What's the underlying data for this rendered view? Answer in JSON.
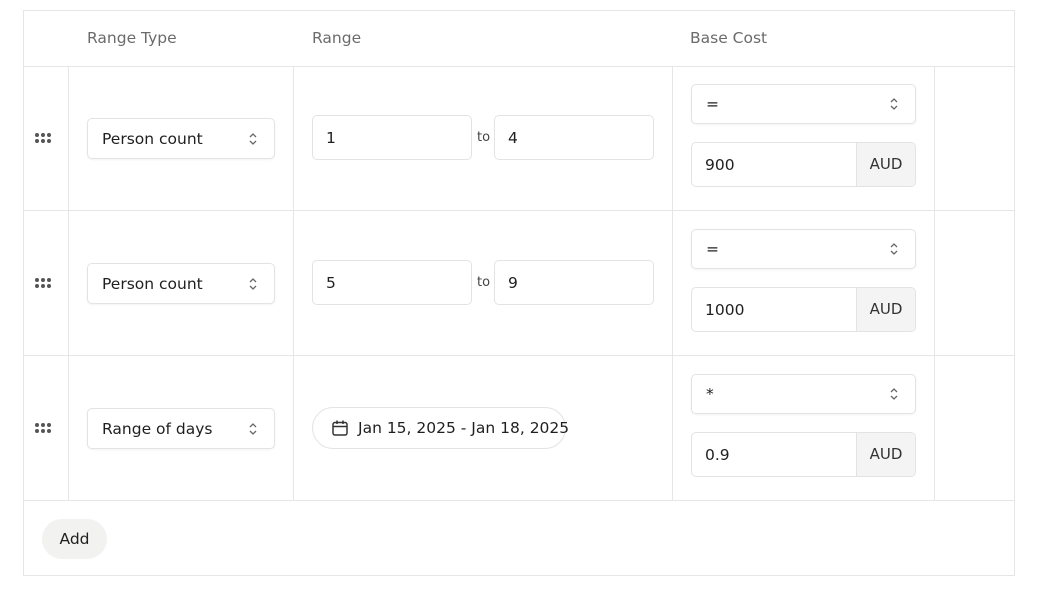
{
  "header": {
    "range_type": "Range Type",
    "range": "Range",
    "base_cost": "Base Cost"
  },
  "rows": [
    {
      "range_type": "Person count",
      "range_from": "1",
      "to_label": "to",
      "range_to": "4",
      "operator": "=",
      "cost_value": "900",
      "currency": "AUD"
    },
    {
      "range_type": "Person count",
      "range_from": "5",
      "to_label": "to",
      "range_to": "9",
      "operator": "=",
      "cost_value": "1000",
      "currency": "AUD"
    },
    {
      "range_type": "Range of days",
      "date_range": "Jan 15, 2025 - Jan 18, 2025",
      "operator": "*",
      "cost_value": "0.9",
      "currency": "AUD"
    }
  ],
  "footer": {
    "add_label": "Add"
  },
  "icons": {
    "drag": "drag-handle-icon",
    "chevron": "chevron-up-down-icon",
    "calendar": "calendar-icon"
  }
}
